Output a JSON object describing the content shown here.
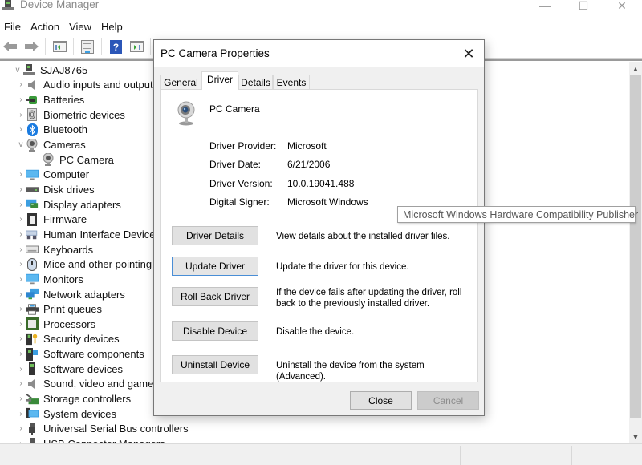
{
  "window": {
    "title": "Device Manager",
    "controls": {
      "minimize": "—",
      "maximize": "☐",
      "close": "✕"
    }
  },
  "menu": [
    "File",
    "Action",
    "View",
    "Help"
  ],
  "toolbar": {
    "buttons": [
      "back-arrow-icon",
      "forward-arrow-icon",
      "show-hide-console-tree-icon",
      "properties-icon",
      "help-icon",
      "action-pane-icon",
      "scan-hardware-icon"
    ]
  },
  "tree": {
    "root": "SJAJ8765",
    "items": [
      {
        "label": "Audio inputs and outputs",
        "icon": "speaker-icon",
        "expanded": false
      },
      {
        "label": "Batteries",
        "icon": "battery-icon",
        "expanded": false
      },
      {
        "label": "Biometric devices",
        "icon": "fingerprint-icon",
        "expanded": false
      },
      {
        "label": "Bluetooth",
        "icon": "bluetooth-icon",
        "expanded": false
      },
      {
        "label": "Cameras",
        "icon": "webcam-icon",
        "expanded": true,
        "children": [
          "PC Camera"
        ]
      },
      {
        "label": "Computer",
        "icon": "computer-icon",
        "expanded": false
      },
      {
        "label": "Disk drives",
        "icon": "disk-drive-icon",
        "expanded": false
      },
      {
        "label": "Display adapters",
        "icon": "display-adapter-icon",
        "expanded": false
      },
      {
        "label": "Firmware",
        "icon": "firmware-chip-icon",
        "expanded": false
      },
      {
        "label": "Human Interface Devices",
        "icon": "hid-icon",
        "expanded": false
      },
      {
        "label": "Keyboards",
        "icon": "keyboard-icon",
        "expanded": false
      },
      {
        "label": "Mice and other pointing devices",
        "icon": "mouse-icon",
        "expanded": false
      },
      {
        "label": "Monitors",
        "icon": "monitor-icon",
        "expanded": false
      },
      {
        "label": "Network adapters",
        "icon": "network-icon",
        "expanded": false
      },
      {
        "label": "Print queues",
        "icon": "printer-icon",
        "expanded": false
      },
      {
        "label": "Processors",
        "icon": "processor-icon",
        "expanded": false
      },
      {
        "label": "Security devices",
        "icon": "security-key-icon",
        "expanded": false
      },
      {
        "label": "Software components",
        "icon": "software-component-icon",
        "expanded": false
      },
      {
        "label": "Software devices",
        "icon": "software-device-icon",
        "expanded": false
      },
      {
        "label": "Sound, video and game controllers",
        "icon": "speaker-icon",
        "expanded": false
      },
      {
        "label": "Storage controllers",
        "icon": "storage-controller-icon",
        "expanded": false
      },
      {
        "label": "System devices",
        "icon": "system-devices-icon",
        "expanded": false
      },
      {
        "label": "Universal Serial Bus controllers",
        "icon": "usb-icon",
        "expanded": false
      },
      {
        "label": "USB Connector Managers",
        "icon": "usb-icon",
        "expanded": false
      }
    ]
  },
  "dialog": {
    "title": "PC Camera Properties",
    "close": "✕",
    "tabs": [
      {
        "label": "General",
        "active": false
      },
      {
        "label": "Driver",
        "active": true
      },
      {
        "label": "Details",
        "active": false
      },
      {
        "label": "Events",
        "active": false
      }
    ],
    "device_name": "PC Camera",
    "info": [
      {
        "label": "Driver Provider:",
        "value": "Microsoft"
      },
      {
        "label": "Driver Date:",
        "value": "6/21/2006"
      },
      {
        "label": "Driver Version:",
        "value": "10.0.19041.488"
      },
      {
        "label": "Digital Signer:",
        "value": "Microsoft Windows"
      }
    ],
    "actions": [
      {
        "button": "Driver Details",
        "description": "View details about the installed driver files."
      },
      {
        "button": "Update Driver",
        "description": "Update the driver for this device."
      },
      {
        "button": "Roll Back Driver",
        "description": "If the device fails after updating the driver, roll back to the previously installed driver."
      },
      {
        "button": "Disable Device",
        "description": "Disable the device."
      },
      {
        "button": "Uninstall Device",
        "description": "Uninstall the device from the system (Advanced)."
      }
    ],
    "footer": {
      "close": "Close",
      "cancel": "Cancel"
    }
  },
  "tooltip": "Microsoft Windows Hardware Compatibility Publisher",
  "colors": {
    "focus_border": "#4a8ed6",
    "accent_blue": "#0078d7"
  }
}
